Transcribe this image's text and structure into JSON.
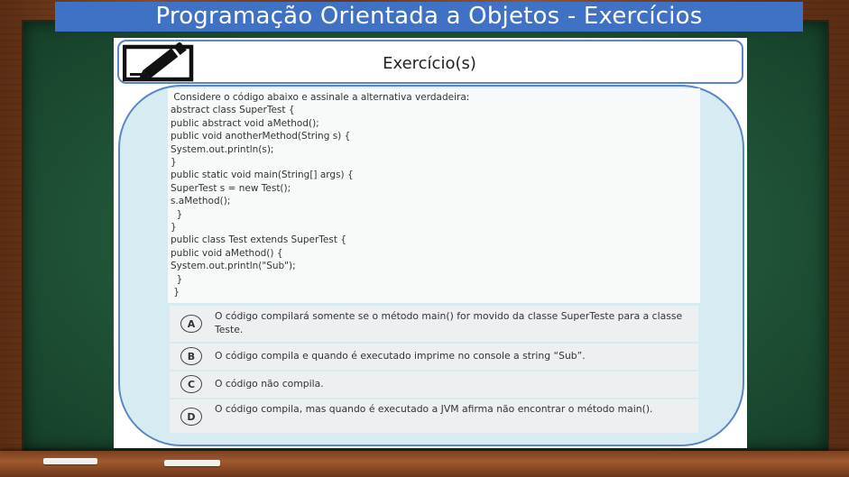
{
  "slide": {
    "title": "Programação Orientada a Objetos - Exercícios",
    "header": "Exercício(s)",
    "header_icon": "pencil-square-icon"
  },
  "question": {
    "prompt": " Considere o código abaixo e assinale a alternativa verdadeira:",
    "code_lines": [
      "abstract class SuperTest {",
      "public abstract void aMethod();",
      "public void anotherMethod(String s) {",
      "System.out.println(s);",
      "}",
      "public static void main(String[] args) {",
      "SuperTest s = new Test();",
      "s.aMethod();",
      "  }",
      "}",
      "public class Test extends SuperTest {",
      "public void aMethod() {",
      "System.out.println(\"Sub\");",
      "  }",
      " }"
    ]
  },
  "options": [
    {
      "letter": "A",
      "text": "O código compilará somente se o método main() for movido da classe SuperTeste para a classe Teste."
    },
    {
      "letter": "B",
      "text": "O código compila e quando é executado imprime no console a string “Sub”."
    },
    {
      "letter": "C",
      "text": "O código não compila."
    },
    {
      "letter": "D",
      "text": "O código compila, mas quando é executado a JVM afirma não encontrar o método main()."
    }
  ],
  "colors": {
    "banner": "#3f72c4",
    "board": "#1f5236",
    "frame": "#7a4021",
    "content_bg": "#d7ecf2",
    "border": "#5b86c5"
  }
}
